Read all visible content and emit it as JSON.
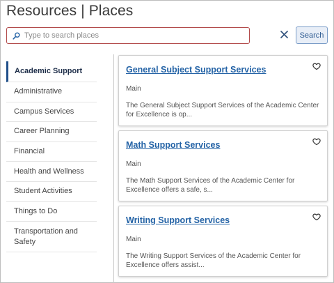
{
  "header": {
    "title": "Resources | Places"
  },
  "search": {
    "placeholder": "Type to search places",
    "button_label": "Search"
  },
  "sidebar": {
    "items": [
      {
        "label": "Academic Support",
        "active": true
      },
      {
        "label": "Administrative"
      },
      {
        "label": "Campus Services"
      },
      {
        "label": "Career Planning"
      },
      {
        "label": "Financial"
      },
      {
        "label": "Health and Wellness"
      },
      {
        "label": "Student Activities"
      },
      {
        "label": "Things to Do"
      },
      {
        "label": "Transportation and Safety"
      }
    ]
  },
  "results": [
    {
      "title": "General Subject Support Services",
      "location": "Main",
      "description": "The General Subject Support Services of the Academic Center for Excellence is op..."
    },
    {
      "title": "Math Support Services",
      "location": "Main",
      "description": "The Math Support Services of the Academic Center for Excellence offers a safe, s..."
    },
    {
      "title": "Writing Support Services",
      "location": "Main",
      "description": "The Writing Support Services of the Academic Center for Excellence offers assist..."
    }
  ],
  "icons": {
    "search": "search-icon",
    "clear": "close-icon",
    "favorite": "heart-icon"
  },
  "colors": {
    "accent": "#2463a6",
    "search_border": "#b24a4a",
    "active_marker": "#1f4e89"
  }
}
